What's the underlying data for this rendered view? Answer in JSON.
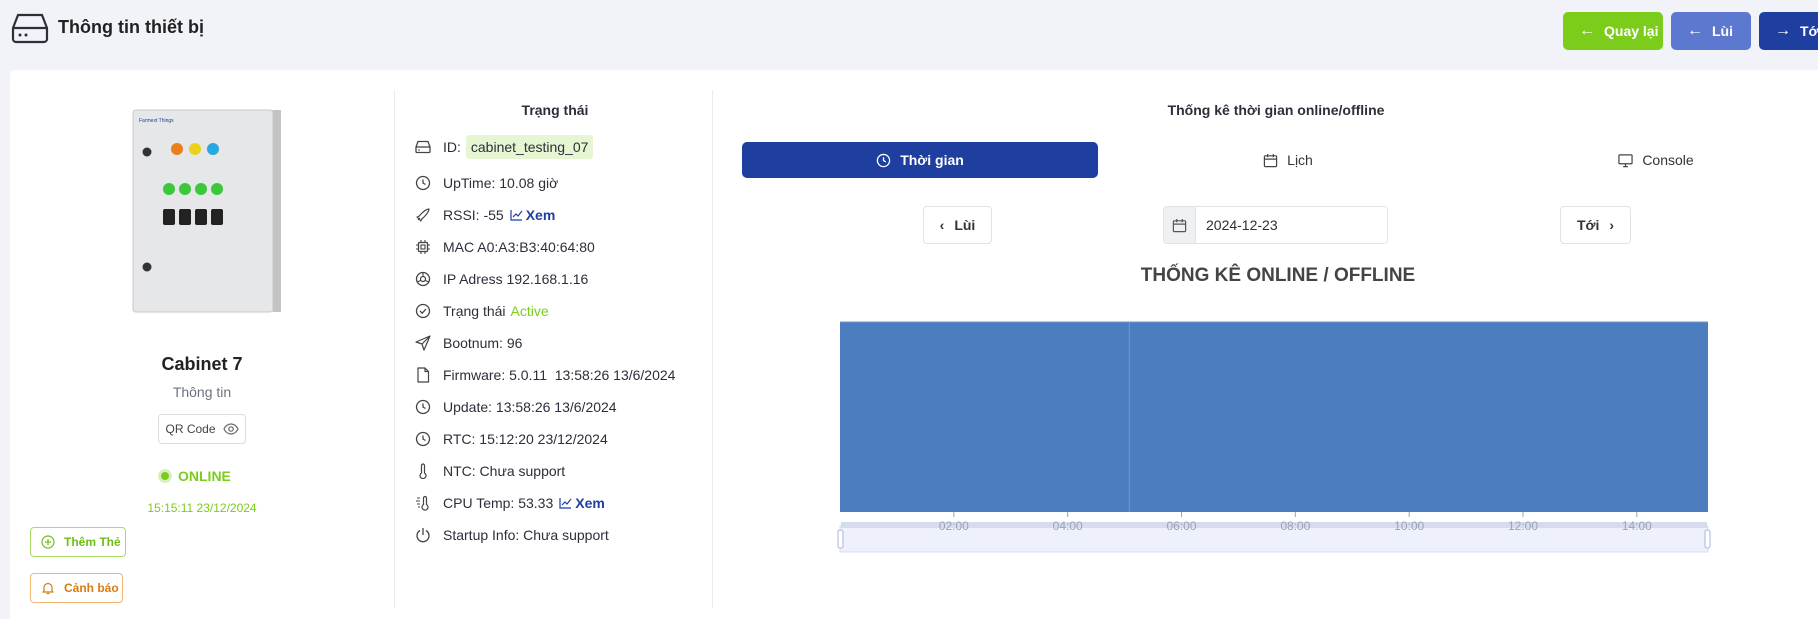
{
  "header": {
    "title": "Thông tin thiết bị",
    "back_label": "Quay lại",
    "prev_label": "Lùi",
    "next_label": "Tới"
  },
  "device": {
    "name": "Cabinet 7",
    "subtitle": "Thông tin",
    "qr_label": "QR Code",
    "status": "ONLINE",
    "status_time": "15:15:11 23/12/2024",
    "add_card_label": "Thêm Thẻ",
    "alert_label": "Cảnh báo",
    "image_brand": "Farmext Things"
  },
  "status_panel": {
    "title": "Trạng thái",
    "id_label": "ID:",
    "id_value": "cabinet_testing_07",
    "uptime": "UpTime: 10.08 giờ",
    "rssi": "RSSI: -55",
    "view_label": "Xem",
    "mac": "MAC A0:A3:B3:40:64:80",
    "ip": "IP Adress 192.168.1.16",
    "state_label": "Trạng thái",
    "state_value": "Active",
    "bootnum": "Bootnum: 96",
    "firmware": "Firmware: 5.0.11  13:58:26 13/6/2024",
    "update": "Update: 13:58:26 13/6/2024",
    "rtc": "RTC: 15:12:20 23/12/2024",
    "ntc": "NTC: Chưa support",
    "cpu_temp": "CPU Temp: 53.33",
    "startup": "Startup Info: Chưa support"
  },
  "stats": {
    "title": "Thống kê thời gian online/offline",
    "tabs": [
      {
        "label": "Thời gian",
        "icon": "clock-icon",
        "active": true
      },
      {
        "label": "Lịch",
        "icon": "calendar-icon",
        "active": false
      },
      {
        "label": "Console",
        "icon": "monitor-icon",
        "active": false
      }
    ],
    "prev_label": "Lùi",
    "next_label": "Tới",
    "date": "2024-12-23",
    "chart_title": "THỐNG KÊ ONLINE / OFFLINE"
  },
  "colors": {
    "green": "#7ccc1c",
    "primary": "#1e3fa0",
    "secondary": "#5d78cf",
    "chart_fill": "#4c7ebf"
  },
  "chart_data": {
    "type": "area",
    "title": "THỐNG KÊ ONLINE / OFFLINE",
    "x_ticks": [
      "02:00",
      "04:00",
      "06:00",
      "08:00",
      "10:00",
      "12:00",
      "14:00"
    ],
    "x_range": [
      "00:00",
      "15:15"
    ],
    "series": [
      {
        "segments": [
          {
            "start": "00:00",
            "end": "05:05"
          },
          {
            "start": "05:05",
            "end": "15:15"
          }
        ]
      }
    ],
    "grid": false,
    "data_zoom": true
  }
}
